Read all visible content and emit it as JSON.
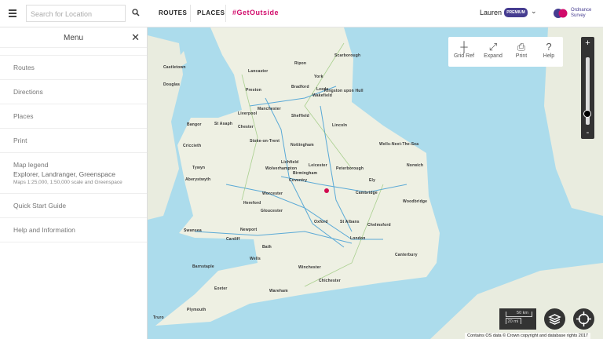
{
  "header": {
    "search_placeholder": "Search for Location",
    "nav": [
      "ROUTES",
      "PLACES",
      "#GetOutside"
    ],
    "user": "Lauren",
    "badge": "PREMIUM",
    "logo_text": "Ordnance Survey",
    "accent": "#d10a6a",
    "brand": "#453c90"
  },
  "menu": {
    "title": "Menu",
    "items": [
      "Routes",
      "Directions",
      "Places",
      "Print"
    ],
    "legend": {
      "title": "Map legend",
      "subtitle": "Explorer, Landranger, Greenspace",
      "detail": "Maps 1:25,000, 1:50,000 scale and Greenspace"
    },
    "items2": [
      "Quick Start Guide",
      "Help and Information"
    ]
  },
  "map_tools": [
    {
      "label": "Grid Ref",
      "icon": "crosshair-icon"
    },
    {
      "label": "Expand",
      "icon": "expand-icon"
    },
    {
      "label": "Print",
      "icon": "printer-icon"
    },
    {
      "label": "Help",
      "icon": "question-icon"
    }
  ],
  "zoom": {
    "plus": "+",
    "minus": "-",
    "level": 0.8
  },
  "scale": {
    "km": "50 km",
    "mi": "20 mi"
  },
  "copyright": "Contains OS data © Crown copyright and database rights 2017",
  "places": [
    "Scarborough",
    "Lancaster",
    "Ripon",
    "York",
    "Bradford",
    "Leeds",
    "Preston",
    "Wakefield",
    "Kingston upon Hull",
    "Liverpool",
    "Manchester",
    "Sheffield",
    "Lincoln",
    "Bangor",
    "St Asaph",
    "Chester",
    "Stoke-on-Trent",
    "Nottingham",
    "Wells-Next-The-Sea",
    "Norwich",
    "Criccieth",
    "Lichfield",
    "Leicester",
    "Peterborough",
    "Tywyn",
    "Wolverhampton",
    "Birmingham",
    "Coventry",
    "Ely",
    "Aberystwyth",
    "Cambridge",
    "Worcester",
    "Hereford",
    "Woodbridge",
    "Gloucester",
    "St Albans",
    "Oxford",
    "Chelmsford",
    "Swansea",
    "Newport",
    "London",
    "Cardiff",
    "Bath",
    "Wells",
    "Canterbury",
    "Winchester",
    "Barnstaple",
    "Chichester",
    "Exeter",
    "Plymouth",
    "Truro",
    "Castletown",
    "Douglas",
    "Wareham"
  ]
}
